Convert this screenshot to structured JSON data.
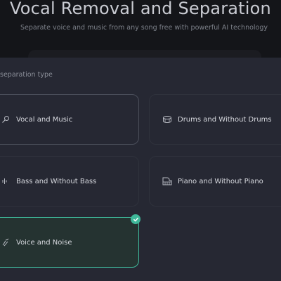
{
  "header": {
    "title": "Vocal Removal and Separation",
    "subtitle": "Separate voice and music from any song free with powerful AI technology"
  },
  "section": {
    "label": "separation type"
  },
  "options": [
    {
      "label": "Vocal and Music",
      "icon": "microphone-icon",
      "selected": false
    },
    {
      "label": "Drums and Without Drums",
      "icon": "drum-icon",
      "selected": false
    },
    {
      "label": "Bass and Without Bass",
      "icon": "bass-waveform-icon",
      "selected": false
    },
    {
      "label": "Piano and Without Piano",
      "icon": "piano-icon",
      "selected": false
    },
    {
      "label": "Voice and Noise",
      "icon": "noise-wave-icon",
      "selected": true
    }
  ],
  "colors": {
    "accent": "#3fb89a",
    "background": "#141519",
    "panel": "#262833"
  }
}
